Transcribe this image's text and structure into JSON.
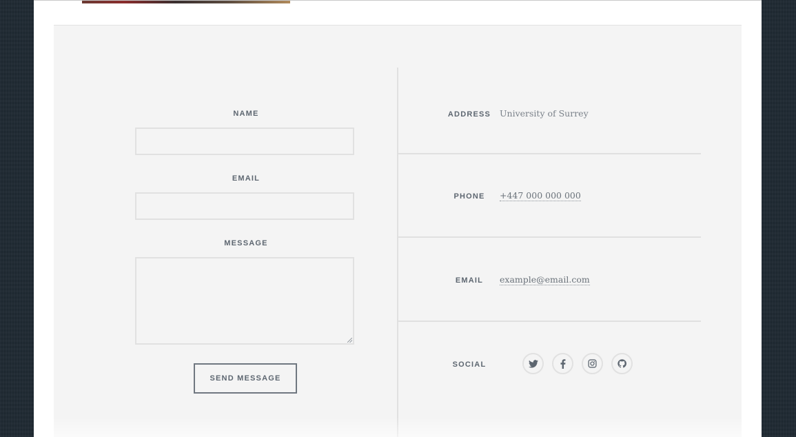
{
  "form": {
    "name_label": "NAME",
    "email_label": "EMAIL",
    "message_label": "MESSAGE",
    "name_value": "",
    "email_value": "",
    "message_value": "",
    "submit_label": "SEND MESSAGE"
  },
  "info": {
    "address_label": "ADDRESS",
    "address_value": "University of Surrey",
    "phone_label": "PHONE",
    "phone_value": "+447 000 000 000",
    "email_label": "EMAIL",
    "email_value": "example@email.com",
    "social_label": "SOCIAL"
  },
  "social": [
    {
      "icon": "twitter-icon"
    },
    {
      "icon": "facebook-icon"
    },
    {
      "icon": "instagram-icon"
    },
    {
      "icon": "github-icon"
    }
  ],
  "colors": {
    "text_label": "#5d6670",
    "text_value": "#7a8189",
    "section_bg": "#f4f4f4",
    "page_bg": "#1f2a33"
  }
}
